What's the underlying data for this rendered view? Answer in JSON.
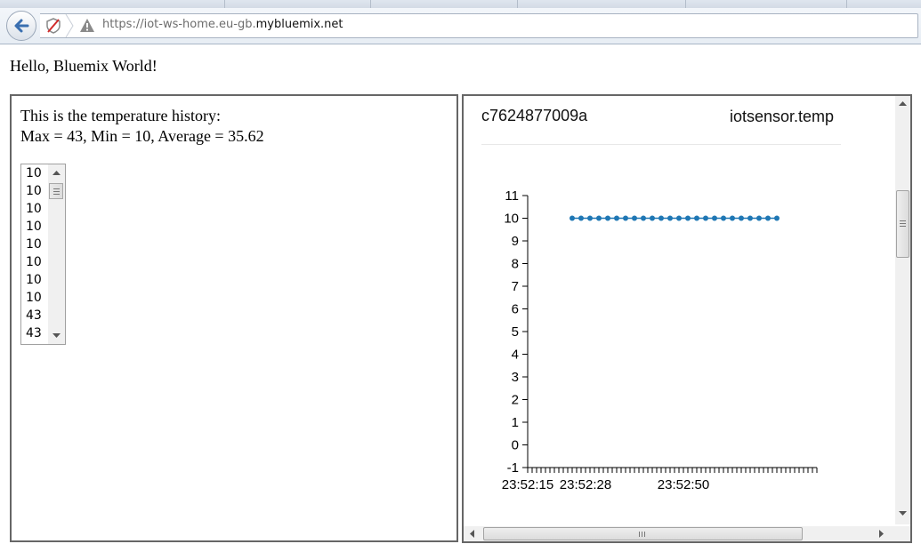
{
  "browser": {
    "url_prefix": "https://iot-ws-home.eu-gb.",
    "url_domain": "mybluemix.net",
    "icons": [
      "back-arrow-icon",
      "tracking-protection-icon",
      "security-warning-icon"
    ]
  },
  "page": {
    "greeting": "Hello, Bluemix World!",
    "history_title": "This is the temperature history:",
    "stats": "Max = 43, Min = 10, Average = 35.62",
    "history_values": [
      "10",
      "10",
      "10",
      "10",
      "10",
      "10",
      "10",
      "10",
      "43",
      "43"
    ]
  },
  "monitor": {
    "device_id": "c7624877009a",
    "sensor": "iotsensor.temp"
  },
  "chart_data": {
    "type": "line",
    "title": "",
    "xlabel": "",
    "ylabel": "",
    "ylim": [
      -1,
      11
    ],
    "yticks": [
      -1,
      0,
      1,
      2,
      3,
      4,
      5,
      6,
      7,
      8,
      9,
      10,
      11
    ],
    "xtick_labels": [
      "23:52:15",
      "23:52:28",
      "23:52:50"
    ],
    "x_seconds_after": "23:52:15",
    "x_range_seconds": [
      0,
      65
    ],
    "x": [
      10,
      12,
      14,
      16,
      18,
      20,
      22,
      24,
      26,
      28,
      30,
      32,
      34,
      36,
      38,
      40,
      42,
      44,
      46,
      48,
      50,
      52,
      54,
      56
    ],
    "series": [
      {
        "values": [
          10,
          10,
          10,
          10,
          10,
          10,
          10,
          10,
          10,
          10,
          10,
          10,
          10,
          10,
          10,
          10,
          10,
          10,
          10,
          10,
          10,
          10,
          10,
          10
        ]
      }
    ],
    "line_color": "#1f77b4",
    "grid": false
  }
}
